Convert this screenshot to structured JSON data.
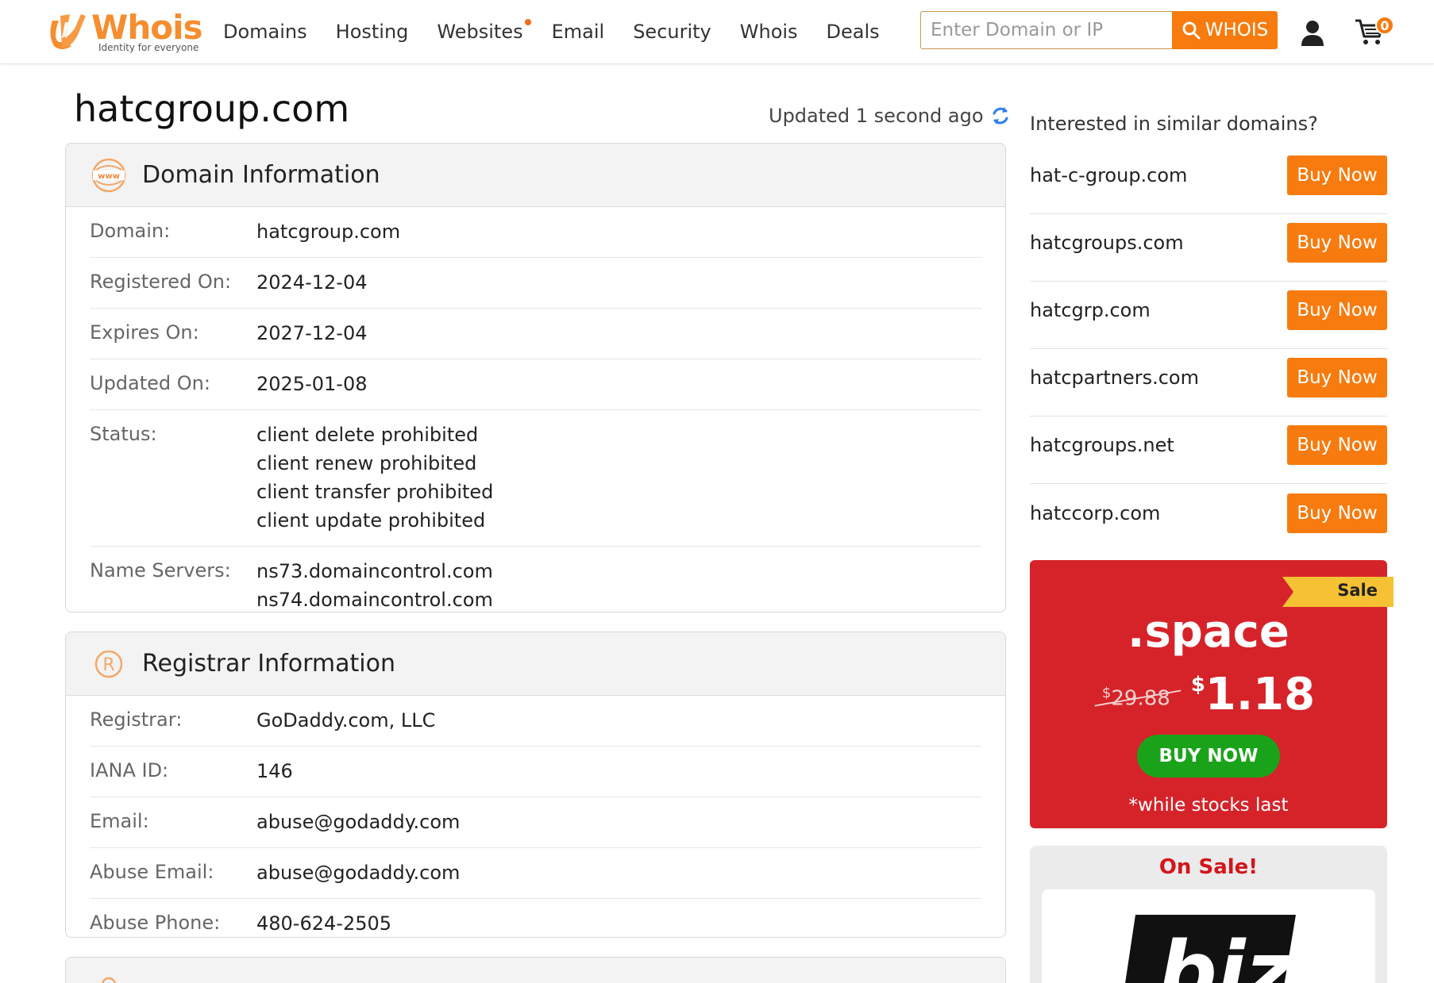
{
  "header": {
    "logo_word": "Whois",
    "logo_tagline": "Identity for everyone",
    "nav": [
      "Domains",
      "Hosting",
      "Websites",
      "Email",
      "Security",
      "Whois",
      "Deals"
    ],
    "search_placeholder": "Enter Domain or IP",
    "search_button": "WHOIS",
    "cart_count": "0",
    "brand_color": "#f77b0e"
  },
  "page": {
    "title": "hatcgroup.com",
    "updated": "Updated 1 second ago"
  },
  "domain_info": {
    "heading": "Domain Information",
    "rows": [
      {
        "label": "Domain:",
        "values": [
          "hatcgroup.com"
        ]
      },
      {
        "label": "Registered On:",
        "values": [
          "2024-12-04"
        ]
      },
      {
        "label": "Expires On:",
        "values": [
          "2027-12-04"
        ]
      },
      {
        "label": "Updated On:",
        "values": [
          "2025-01-08"
        ]
      },
      {
        "label": "Status:",
        "values": [
          "client delete prohibited",
          "client renew prohibited",
          "client transfer prohibited",
          "client update prohibited"
        ]
      },
      {
        "label": "Name Servers:",
        "values": [
          "ns73.domaincontrol.com",
          "ns74.domaincontrol.com"
        ]
      }
    ]
  },
  "registrar_info": {
    "heading": "Registrar Information",
    "rows": [
      {
        "label": "Registrar:",
        "values": [
          "GoDaddy.com, LLC"
        ]
      },
      {
        "label": "IANA ID:",
        "values": [
          "146"
        ]
      },
      {
        "label": "Email:",
        "values": [
          "abuse@godaddy.com"
        ]
      },
      {
        "label": "Abuse Email:",
        "values": [
          "abuse@godaddy.com"
        ]
      },
      {
        "label": "Abuse Phone:",
        "values": [
          "480-624-2505"
        ]
      }
    ]
  },
  "sidebar": {
    "title": "Interested in similar domains?",
    "buy_label": "Buy Now",
    "suggestions": [
      "hat-c-group.com",
      "hatcgroups.com",
      "hatcgrp.com",
      "hatcpartners.com",
      "hatcgroups.net",
      "hatccorp.com"
    ],
    "promo": {
      "ribbon": "Sale",
      "tld": ".space",
      "currency": "$",
      "old_price": "29.88",
      "new_price": "1.18",
      "button": "BUY NOW",
      "note": "*while stocks last",
      "bg_color": "#d6232a"
    },
    "onsale": {
      "title": "On Sale!",
      "logo_text": ".biz"
    }
  }
}
